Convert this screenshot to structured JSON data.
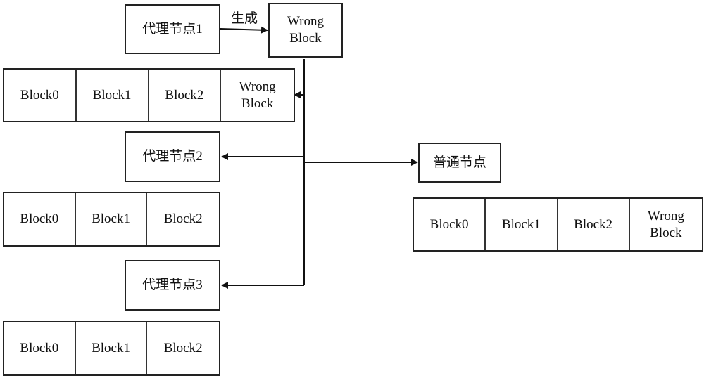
{
  "nodes": {
    "proxy1": "代理节点1",
    "proxy2": "代理节点2",
    "proxy3": "代理节点3",
    "normal": "普通节点",
    "wrong_block": "Wrong\nBlock"
  },
  "edge_labels": {
    "generate": "生成"
  },
  "chains": {
    "chain1": [
      "Block0",
      "Block1",
      "Block2",
      "Wrong\nBlock"
    ],
    "chain2": [
      "Block0",
      "Block1",
      "Block2"
    ],
    "chain3": [
      "Block0",
      "Block1",
      "Block2"
    ],
    "chain_normal": [
      "Block0",
      "Block1",
      "Block2",
      "Wrong\nBlock"
    ]
  },
  "colors": {
    "stroke": "#222222",
    "background": "#ffffff"
  }
}
